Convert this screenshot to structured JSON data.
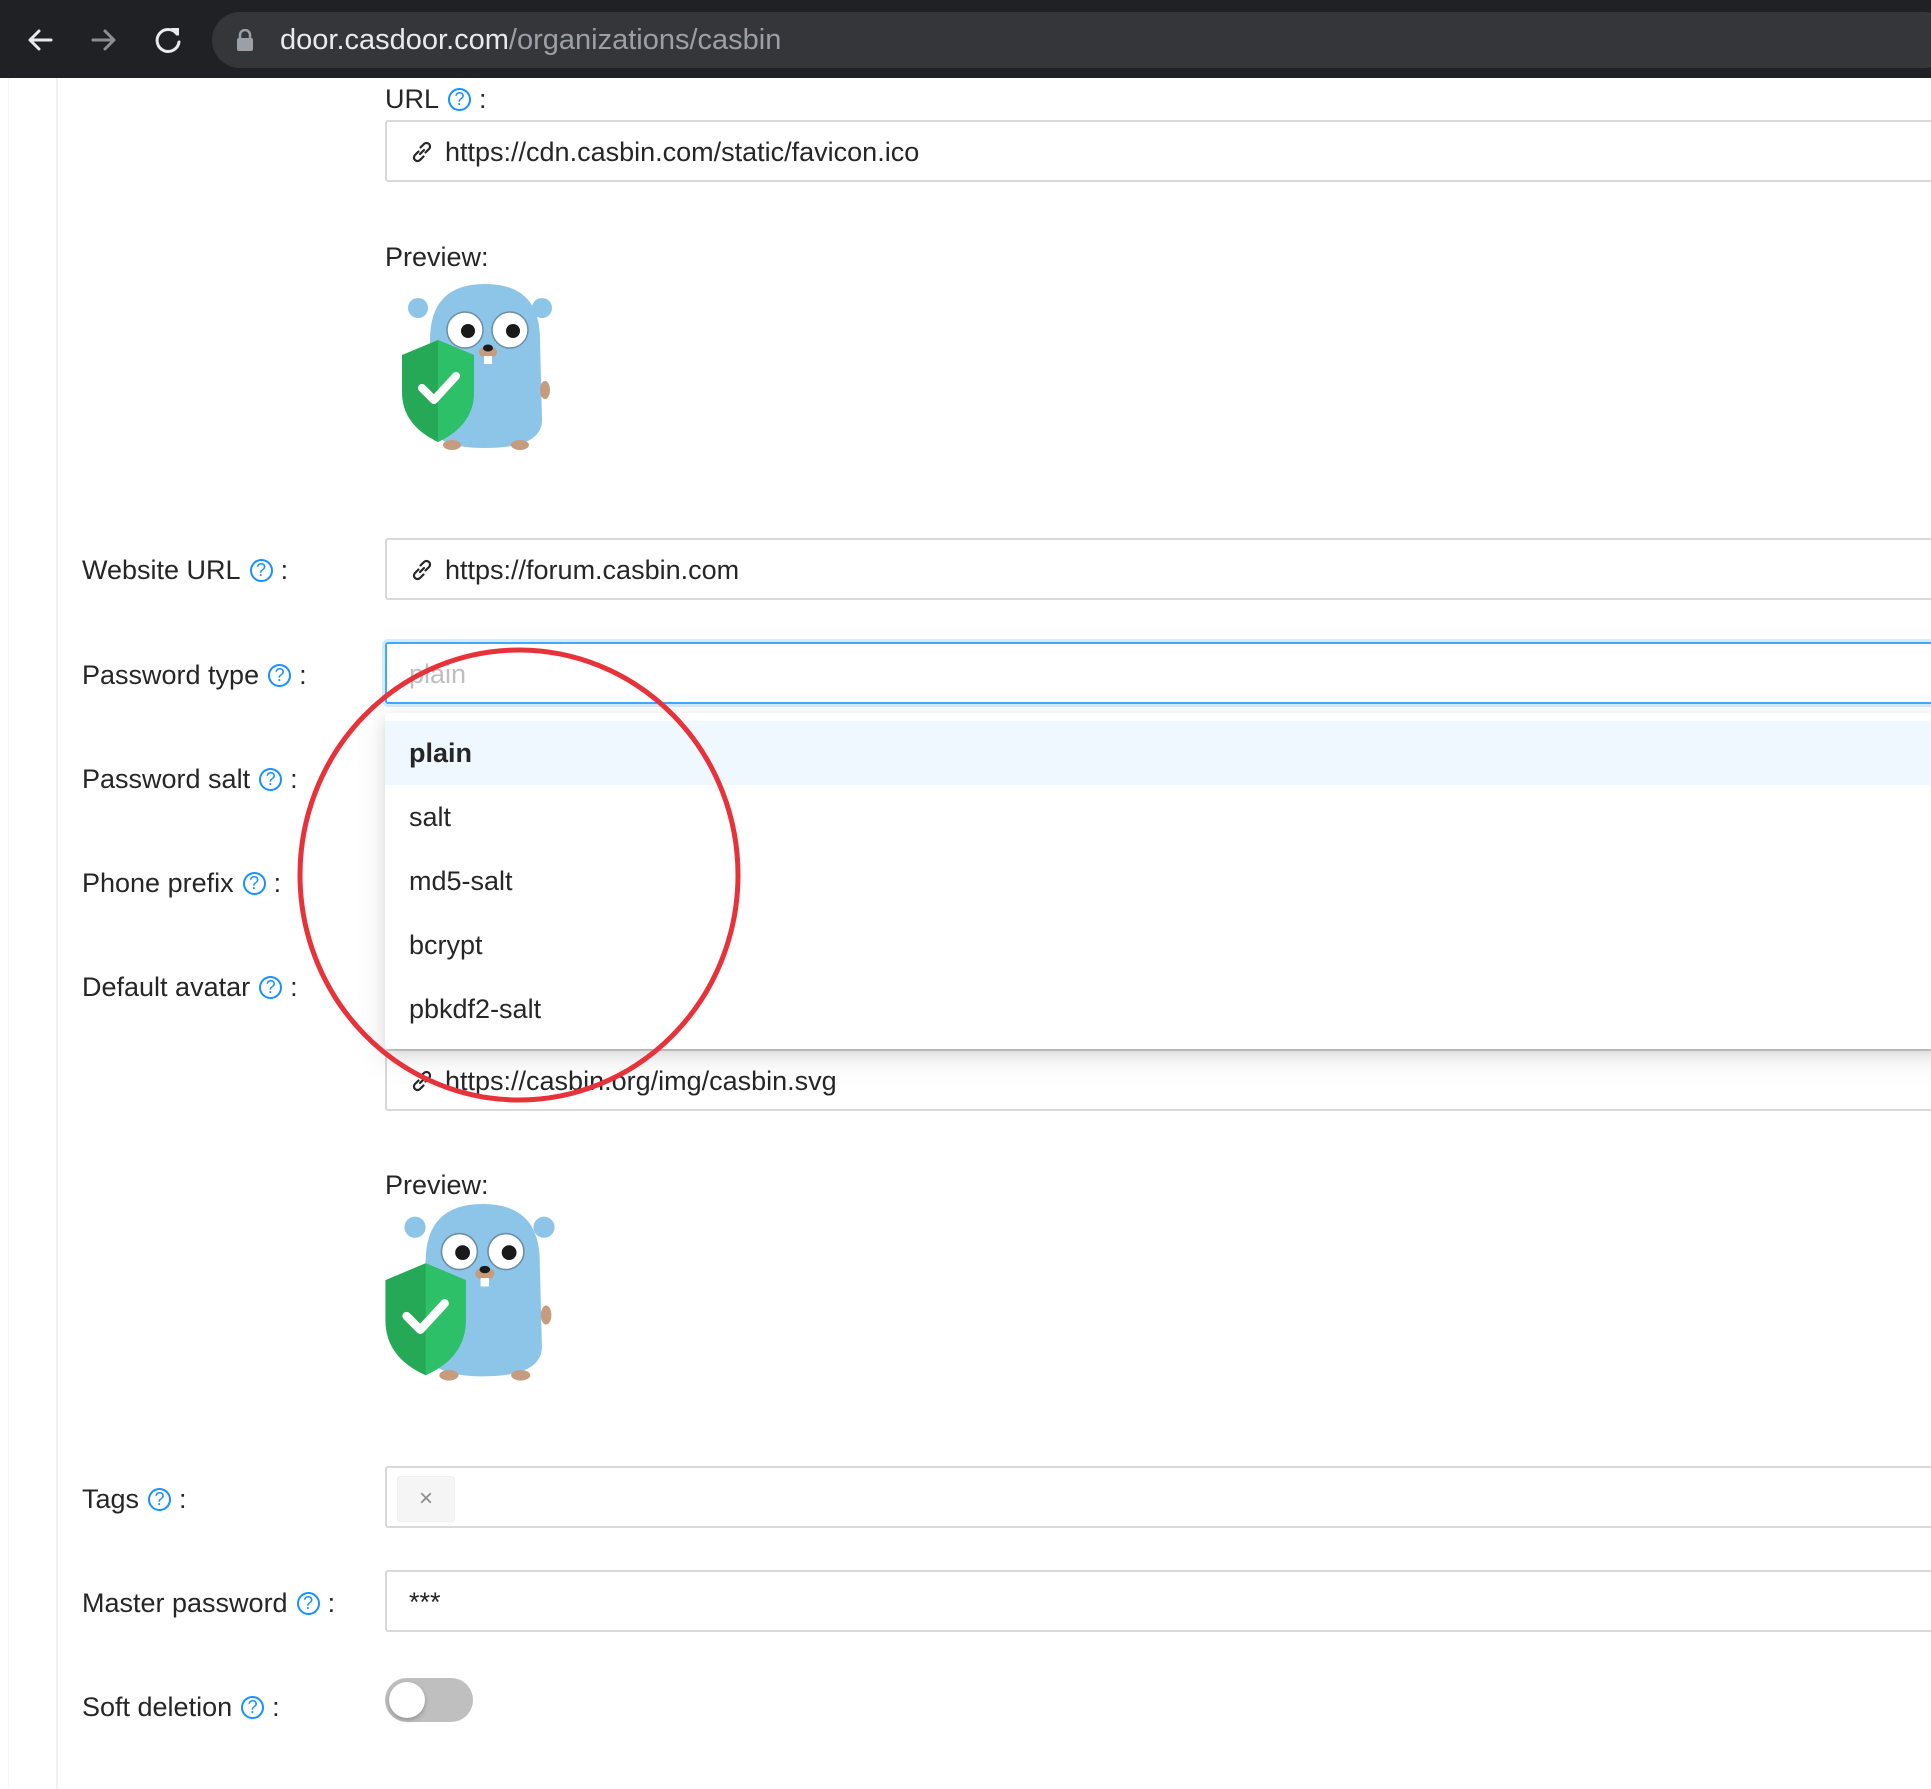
{
  "browser": {
    "url_host": "door.casdoor.com",
    "url_path": "/organizations/casbin"
  },
  "form": {
    "favicon": {
      "label": "URL",
      "value": "https://cdn.casbin.com/static/favicon.ico",
      "preview_label": "Preview:"
    },
    "website_url": {
      "label": "Website URL",
      "value": "https://forum.casbin.com"
    },
    "password_type": {
      "label": "Password type",
      "placeholder": "plain",
      "options": [
        "plain",
        "salt",
        "md5-salt",
        "bcrypt",
        "pbkdf2-salt"
      ],
      "selected": "plain"
    },
    "password_salt": {
      "label": "Password salt"
    },
    "phone_prefix": {
      "label": "Phone prefix"
    },
    "default_avatar": {
      "label": "Default avatar",
      "value": "https://casbin.org/img/casbin.svg",
      "preview_label": "Preview:"
    },
    "tags": {
      "label": "Tags",
      "close_glyph": "×"
    },
    "master_password": {
      "label": "Master password",
      "value": "***"
    },
    "soft_deletion": {
      "label": "Soft deletion",
      "enabled": false
    },
    "help_glyph": "?",
    "colon": ":"
  },
  "colors": {
    "accent": "#1890ff",
    "annotation": "#e8323a",
    "chrome": "#202124"
  }
}
